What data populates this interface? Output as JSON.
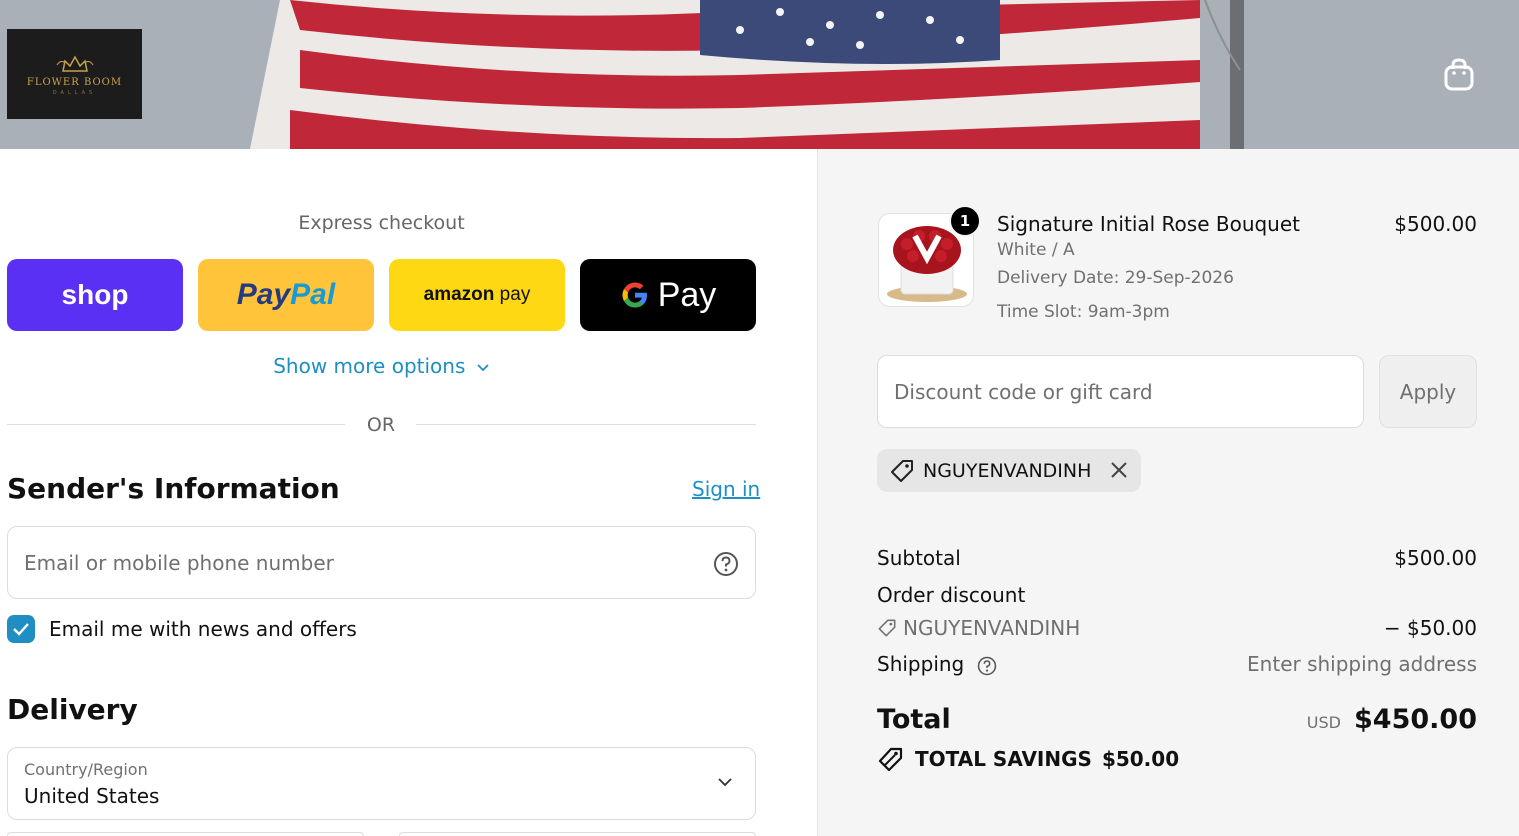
{
  "header": {
    "logo_text": "FLOWER BOOM",
    "logo_sub": "DALLAS",
    "cart_icon": "shopping-bag-icon"
  },
  "express": {
    "title": "Express checkout",
    "shop_label": "shop",
    "paypal_label_1": "Pay",
    "paypal_label_2": "Pal",
    "amazon_label_1": "amazon",
    "amazon_label_2": " pay",
    "gpay_label": "Pay",
    "more_options": "Show more options",
    "or": "OR"
  },
  "sender": {
    "title": "Sender's Information",
    "signin": "Sign in",
    "email_placeholder": "Email or mobile phone number",
    "newsletter_label": "Email me with news and offers",
    "newsletter_checked": true
  },
  "delivery": {
    "title": "Delivery",
    "country_label": "Country/Region",
    "country_value": "United States"
  },
  "order": {
    "product_name": "Signature Initial Rose Bouquet",
    "variant": "White / A",
    "delivery_date": "Delivery Date: 29-Sep-2026",
    "time_slot": "Time Slot: 9am-3pm",
    "price": "$500.00",
    "quantity": "1"
  },
  "discount": {
    "placeholder": "Discount code or gift card",
    "apply": "Apply",
    "applied_code": "NGUYENVANDINH"
  },
  "summary": {
    "subtotal_label": "Subtotal",
    "subtotal_value": "$500.00",
    "order_discount_label": "Order discount",
    "discount_code": "NGUYENVANDINH",
    "discount_value": "− $50.00",
    "shipping_label": "Shipping",
    "shipping_value": "Enter shipping address",
    "total_label": "Total",
    "currency": "USD",
    "total_value": "$450.00",
    "savings_label": "TOTAL SAVINGS",
    "savings_value": "$50.00"
  },
  "colors": {
    "shop_purple": "#5a31f4",
    "paypal_yellow": "#ffc439",
    "amazon_yellow": "#ffd814",
    "link_blue": "#1f8fc3"
  }
}
